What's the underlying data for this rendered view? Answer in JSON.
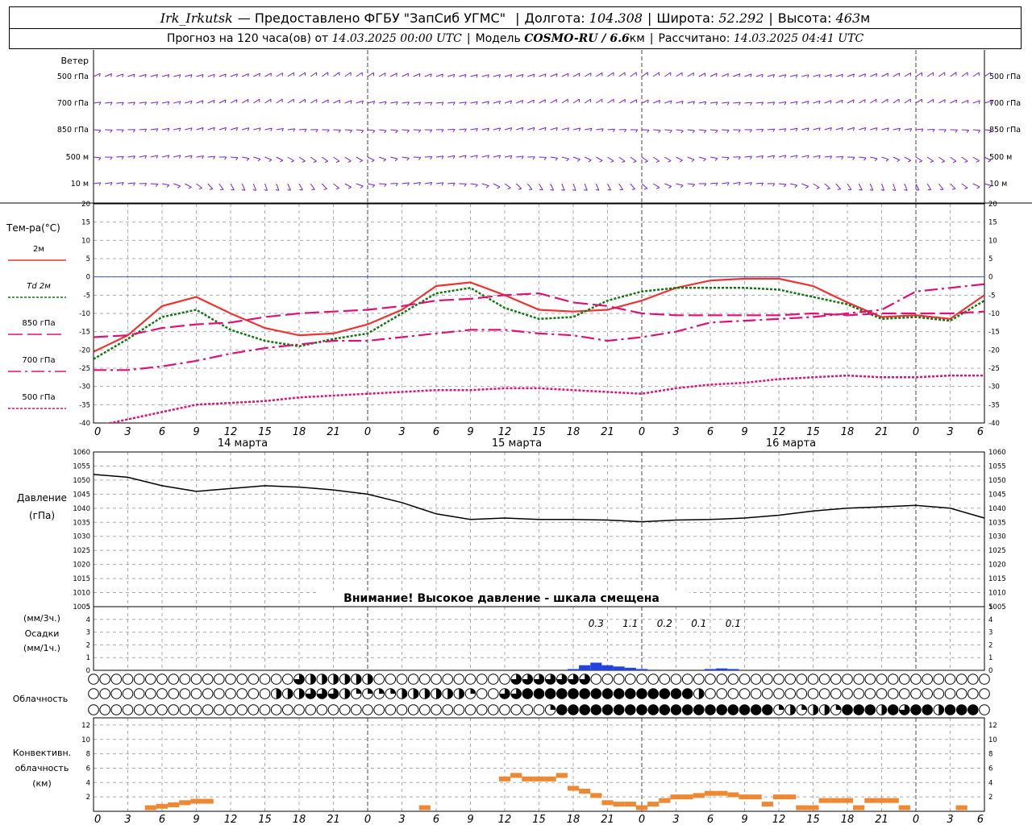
{
  "header": {
    "station": "Irk_Irkutsk",
    "provider": "— Предоставлено ФГБУ \"ЗапСиб УГМС\"",
    "lon_label": "Долгота:",
    "lon": "104.308",
    "lat_label": "Широта:",
    "lat": "52.292",
    "alt_label": "Высота:",
    "alt": "463",
    "alt_unit": "м",
    "forecast_label": "Прогноз на 120 часа(ов) от",
    "forecast_start": "14.03.2025 00:00 UTC",
    "model_label": "Модель",
    "model": "COSMO-RU / 6.6",
    "model_unit": "км",
    "calc_label": "Рассчитано:",
    "calc_time": "14.03.2025 04:41 UTC"
  },
  "labels": {
    "wind": "Ветер",
    "levels": [
      "500 гПа",
      "700 гПа",
      "850 гПа",
      "500 м",
      "10  м"
    ],
    "temp_title": "Тем-ра(°С)",
    "pressure": "Давление",
    "pressure_unit": "(гПа)",
    "pressure_warning": "Внимание! Высокое давление - шкала смещена",
    "precip_3h": "(мм/3ч.)",
    "precip": "Осадки",
    "precip_1h": "(мм/1ч.)",
    "cloud": "Облачность",
    "conv1": "Конвективн.",
    "conv2": "облачность",
    "conv3": "(км)"
  },
  "time_axis": {
    "ticks": [
      "0",
      "3",
      "6",
      "9",
      "12",
      "15",
      "18",
      "21",
      "0",
      "3",
      "6",
      "9",
      "12",
      "15",
      "18",
      "21",
      "0",
      "3",
      "6",
      "9",
      "12",
      "15",
      "18",
      "21",
      "0",
      "3",
      "6"
    ],
    "days": [
      "14 марта",
      "15 марта",
      "16 марта"
    ]
  },
  "colors": {
    "t2m": "#ee3333",
    "td2m": "#117711",
    "t850": "#dd1177",
    "t700": "#dd1177",
    "t500": "#dd1177",
    "wind": "#7722cc",
    "pressure": "#000000",
    "precip": "#2244dd",
    "convective": "#ee8833",
    "zero_line": "#3355ee"
  },
  "chart_data": [
    {
      "type": "line",
      "title": "Тем-ра(°С)",
      "ylim": [
        -40,
        20
      ],
      "yticks": [
        20,
        15,
        10,
        5,
        0,
        -5,
        -10,
        -15,
        -20,
        -25,
        -30,
        -35,
        -40
      ],
      "x_hours": [
        0,
        3,
        6,
        9,
        12,
        15,
        18,
        21,
        24,
        27,
        30,
        33,
        36,
        39,
        42,
        45,
        48,
        51,
        54,
        57,
        60,
        63,
        66,
        69,
        72,
        75,
        78
      ],
      "series": [
        {
          "name": "2м",
          "key": "t2m",
          "values": [
            -20.5,
            -16,
            -8,
            -5.5,
            -10,
            -14,
            -16,
            -15.5,
            -13,
            -9,
            -2.5,
            -1.5,
            -5,
            -9,
            -9.5,
            -9,
            -6.5,
            -3,
            -1,
            -0.5,
            -0.5,
            -2.5,
            -7,
            -11,
            -10.5,
            -11.5,
            -5,
            0
          ]
        },
        {
          "name": "Td  2м",
          "key": "td2m",
          "values": [
            -22.5,
            -17,
            -11,
            -9,
            -14.5,
            -17.5,
            -19,
            -17,
            -15.5,
            -10,
            -4.5,
            -3,
            -8.5,
            -11.5,
            -11,
            -6.5,
            -4,
            -3,
            -3,
            -3,
            -3.5,
            -5.5,
            -7.5,
            -11.5,
            -11,
            -12,
            -6.5,
            -2
          ]
        },
        {
          "name": "850 гПа",
          "key": "t850",
          "values": [
            -16.5,
            -16,
            -14,
            -13,
            -12.5,
            -11,
            -10,
            -9.5,
            -9,
            -8,
            -6.5,
            -6,
            -5,
            -4.5,
            -7,
            -8,
            -10,
            -10.5,
            -10.5,
            -10.5,
            -10.5,
            -10,
            -10.5,
            -10,
            -10,
            -10,
            -9.5,
            -9
          ]
        },
        {
          "name": "700 гПа",
          "key": "t700",
          "values": [
            -25.5,
            -25.5,
            -24.5,
            -23,
            -21,
            -19.5,
            -18.5,
            -17.5,
            -17.5,
            -16.5,
            -15.5,
            -14.5,
            -14.5,
            -15.5,
            -16,
            -17.5,
            -16.5,
            -15,
            -12.5,
            -12,
            -11.5,
            -11,
            -10,
            -9,
            -4,
            -3,
            -2,
            -0.5
          ]
        },
        {
          "name": "500 гПа",
          "key": "t500",
          "values": [
            -41,
            -39,
            -37,
            -35,
            -34.5,
            -34,
            -33,
            -32.5,
            -32,
            -31.5,
            -31,
            -31,
            -30.5,
            -30.5,
            -31,
            -31.5,
            -32,
            -30.5,
            -29.5,
            -29,
            -28,
            -27.5,
            -27,
            -27.5,
            -27.5,
            -27,
            -27,
            -27
          ]
        }
      ]
    },
    {
      "type": "line",
      "title": "Давление",
      "ylabel": "(гПа)",
      "ylim": [
        1005,
        1060
      ],
      "yticks": [
        1060,
        1055,
        1050,
        1045,
        1040,
        1035,
        1030,
        1025,
        1020,
        1015,
        1010,
        1005
      ],
      "x_hours": [
        0,
        3,
        6,
        9,
        12,
        15,
        18,
        21,
        24,
        27,
        30,
        33,
        36,
        39,
        42,
        45,
        48,
        51,
        54,
        57,
        60,
        63,
        66,
        69,
        72,
        75,
        78
      ],
      "series": [
        {
          "name": "Давление",
          "values": [
            1052,
            1051,
            1048,
            1046,
            1047,
            1048,
            1047.5,
            1046.5,
            1045,
            1042,
            1038,
            1036,
            1036.5,
            1036,
            1036,
            1035.8,
            1035.2,
            1035.8,
            1036,
            1036.5,
            1037.5,
            1039,
            1040,
            1040.5,
            1041,
            1040,
            1036.5
          ]
        }
      ]
    },
    {
      "type": "bar",
      "title": "Осадки",
      "ylabel": "(мм/1ч.)",
      "ylim": [
        0,
        5
      ],
      "yticks": [
        5,
        4,
        3,
        2,
        1,
        0
      ],
      "x_hours": [
        42,
        43,
        44,
        45,
        46,
        47,
        48,
        49,
        54,
        55,
        56
      ],
      "values": [
        0.1,
        0.4,
        0.6,
        0.4,
        0.3,
        0.2,
        0.1,
        0.05,
        0.1,
        0.15,
        0.1
      ],
      "annotation_hours": [
        44,
        47,
        50,
        53,
        56
      ],
      "annotations": [
        "0.3",
        "1.1",
        "0.2",
        "0.1",
        "0.1"
      ]
    },
    {
      "type": "bar",
      "title": "Конвективн. облачность",
      "ylabel": "(км)",
      "ylim": [
        0,
        13
      ],
      "yticks": [
        12,
        10,
        8,
        6,
        4,
        2,
        0
      ],
      "x_hours": [
        5,
        6,
        7,
        8,
        9,
        10,
        29,
        36,
        37,
        38,
        39,
        40,
        41,
        42,
        43,
        44,
        45,
        46,
        47,
        48,
        49,
        50,
        51,
        52,
        53,
        54,
        55,
        56,
        57,
        58,
        59,
        60,
        61,
        62,
        63,
        64,
        65,
        66,
        67,
        68,
        69,
        70,
        71,
        76
      ],
      "values": [
        0.5,
        0.7,
        0.9,
        1.2,
        1.4,
        1.4,
        0.5,
        4.5,
        5,
        4.5,
        4.5,
        4.5,
        5,
        3.2,
        2.8,
        2.2,
        1.2,
        1,
        1,
        0.5,
        1,
        1.5,
        2,
        2,
        2.2,
        2.5,
        2.5,
        2.3,
        2,
        2,
        1,
        2,
        2,
        0.5,
        0.5,
        1.5,
        1.5,
        1.5,
        0.5,
        1.5,
        1.5,
        1.5,
        0.5,
        0.5
      ]
    },
    {
      "type": "table",
      "title": "Облачность",
      "x_hours_step": 1,
      "rows": [
        {
          "level": "upper",
          "cover": [
            0,
            0,
            0,
            0,
            0,
            0,
            0,
            0,
            0,
            0,
            0,
            0,
            0,
            0,
            0,
            0,
            0,
            0,
            3,
            2,
            2,
            2,
            2,
            2,
            2,
            0,
            0,
            0,
            0,
            0,
            0,
            0,
            0,
            0,
            0,
            0,
            0,
            3,
            3,
            3,
            3,
            3,
            3,
            3,
            0,
            0,
            0,
            0,
            0,
            0,
            0,
            0,
            0,
            0,
            0,
            0,
            0,
            0,
            0,
            0,
            0,
            0,
            0,
            0,
            0,
            0,
            0,
            0,
            0,
            0,
            0,
            0,
            0,
            0,
            0,
            0,
            0,
            0,
            0
          ]
        },
        {
          "level": "middle",
          "cover": [
            0,
            0,
            0,
            0,
            0,
            0,
            0,
            0,
            0,
            0,
            0,
            0,
            0,
            0,
            0,
            0,
            2,
            2,
            2,
            3,
            3,
            3,
            2,
            1,
            1,
            1,
            1,
            2,
            2,
            2,
            2,
            2,
            2,
            1,
            0,
            0,
            3,
            3,
            4,
            4,
            4,
            4,
            4,
            4,
            4,
            4,
            4,
            4,
            4,
            4,
            4,
            4,
            4,
            2,
            0,
            0,
            0,
            0,
            0,
            0,
            0,
            0,
            0,
            0,
            0,
            0,
            0,
            0,
            0,
            0,
            0,
            0,
            0,
            0,
            0,
            0,
            0,
            0,
            0
          ]
        },
        {
          "level": "lower",
          "cover": [
            0,
            0,
            0,
            0,
            0,
            0,
            0,
            0,
            0,
            0,
            0,
            0,
            0,
            0,
            0,
            0,
            0,
            0,
            0,
            0,
            0,
            0,
            0,
            0,
            0,
            0,
            0,
            0,
            0,
            0,
            0,
            0,
            0,
            0,
            0,
            0,
            0,
            0,
            0,
            0,
            1,
            4,
            4,
            4,
            4,
            4,
            4,
            4,
            4,
            4,
            4,
            4,
            4,
            4,
            4,
            4,
            4,
            4,
            4,
            4,
            1,
            2,
            1,
            2,
            2,
            1,
            4,
            4,
            4,
            2,
            4,
            3,
            4,
            4,
            2,
            4,
            4,
            4,
            0
          ]
        }
      ]
    }
  ]
}
